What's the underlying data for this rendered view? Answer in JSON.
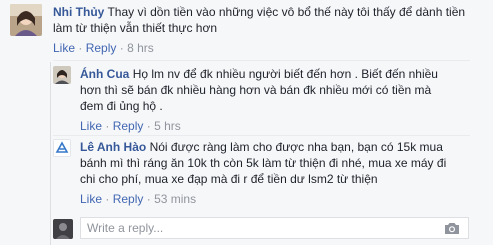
{
  "comments": [
    {
      "author": "Nhi Thủy",
      "lines": [
        "Thay vì dồn tiền vào những việc vô bổ thế này tôi thấy để dành tiền",
        "làm từ thiện vẫn thiết thực hơn"
      ],
      "like": "Like",
      "reply": "Reply",
      "time": "8 hrs",
      "sep": "·"
    },
    {
      "author": "Ánh Cua",
      "lines": [
        "Họ lm nv để đk nhiều người biết đến hơn . Biết đến nhiều",
        "hơn thì sẽ bán đk nhiều hàng hơn và bán đk nhiều mới có tiền mà",
        "đem đi ủng hộ ."
      ],
      "like": "Like",
      "reply": "Reply",
      "time": "5 hrs",
      "sep": "·"
    },
    {
      "author": "Lê Anh Hào",
      "lines": [
        "Nói được ràng làm cho được nha bạn, bạn có 15k mua",
        "bánh mì thì ráng ăn 10k th còn 5k làm từ thiện đi nhé, mua xe máy đi",
        "chi cho phí, mua xe đạp mà đi r để tiền dư lsm2 từ thiện"
      ],
      "like": "Like",
      "reply": "Reply",
      "time": "53 mins",
      "sep": "·"
    }
  ],
  "reply_box": {
    "placeholder": "Write a reply..."
  },
  "icons": {
    "camera": "camera-icon"
  }
}
